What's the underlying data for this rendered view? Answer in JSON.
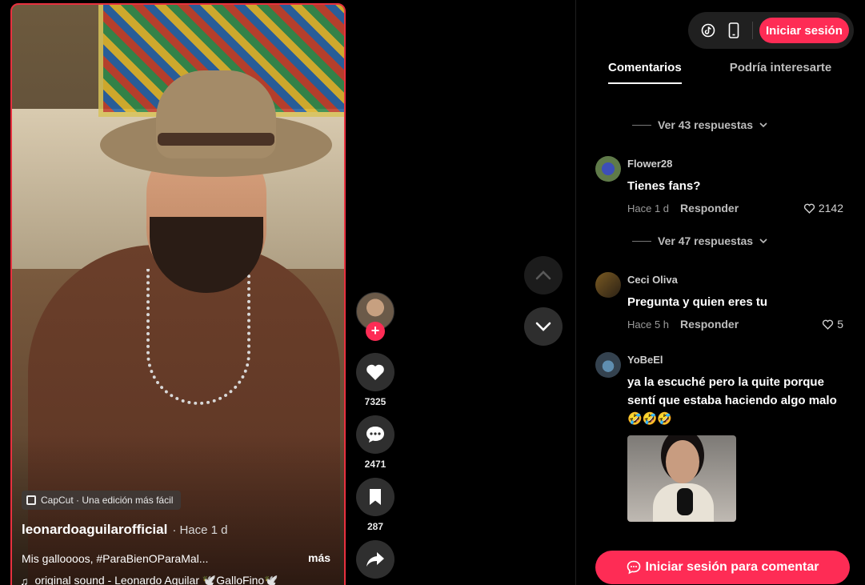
{
  "video": {
    "badge": "CapCut · Una edición más fácil",
    "author": "leonardoaguilarofficial",
    "posted": "· Hace 1 d",
    "description": "Mis galloooos, #ParaBienOParaMal...",
    "more_label": "más",
    "music_icon": "♫",
    "music": "original sound - Leonardo Aguilar 🕊️GalloFino🕊️"
  },
  "actions": {
    "likes": "7325",
    "comments": "2471",
    "saves": "287",
    "follow_glyph": "+"
  },
  "header": {
    "login_label": "Iniciar sesión"
  },
  "tabs": [
    {
      "label": "Comentarios",
      "active": true
    },
    {
      "label": "Podría interesarte",
      "active": false
    }
  ],
  "comments": [
    {
      "user": "Flower28",
      "text": "Tienes fans?",
      "time": "Hace 1 d",
      "reply": "Responder",
      "likes": "2142"
    },
    {
      "user": "Ceci Oliva",
      "text": "Pregunta y quien eres tu",
      "time": "Hace 5 h",
      "reply": "Responder",
      "likes": "5"
    },
    {
      "user": "YoBeEl",
      "text": "ya la escuché pero la quite porque sentí que estaba haciendo algo malo 🤣🤣🤣"
    }
  ],
  "replies": [
    {
      "label": "Ver 43 respuestas"
    },
    {
      "label": "Ver 47 respuestas"
    }
  ],
  "cta": {
    "label": "Iniciar sesión para comentar"
  },
  "colors": {
    "accent": "#fe2c55",
    "panel_bg": "#000000"
  }
}
